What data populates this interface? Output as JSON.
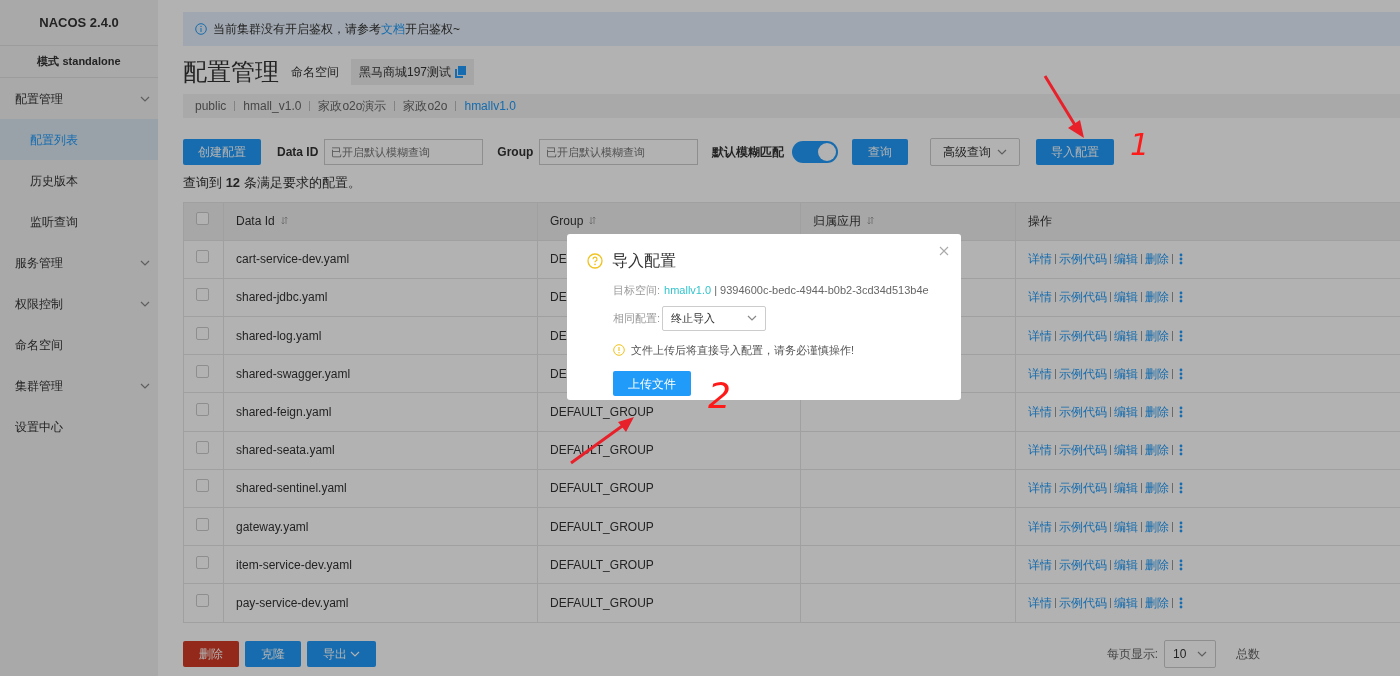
{
  "sidebar": {
    "title": "NACOS 2.4.0",
    "mode": "模式 standalone",
    "items": [
      {
        "label": "配置管理",
        "kind": "group",
        "selected": false,
        "children": [
          {
            "label": "配置列表",
            "selected": true
          },
          {
            "label": "历史版本",
            "selected": false
          },
          {
            "label": "监听查询",
            "selected": false
          }
        ]
      },
      {
        "label": "服务管理",
        "kind": "group",
        "selected": false
      },
      {
        "label": "权限控制",
        "kind": "group",
        "selected": false
      },
      {
        "label": "命名空间",
        "kind": "link",
        "selected": false
      },
      {
        "label": "集群管理",
        "kind": "group",
        "selected": false
      },
      {
        "label": "设置中心",
        "kind": "link",
        "selected": false
      }
    ]
  },
  "notice": {
    "before": "当前集群没有开启鉴权，请参考",
    "link": "文档",
    "after": "开启鉴权~"
  },
  "header": {
    "title": "配置管理",
    "namespace_label": "命名空间",
    "namespace": "黑马商城197测试"
  },
  "namespaces": [
    {
      "label": "public",
      "selected": false
    },
    {
      "label": "hmall_v1.0",
      "selected": false
    },
    {
      "label": "家政o2o演示",
      "selected": false
    },
    {
      "label": "家政o2o",
      "selected": false
    },
    {
      "label": "hmallv1.0",
      "selected": true
    }
  ],
  "toolbar": {
    "create": "创建配置",
    "dataid_label": "Data ID",
    "dataid_placeholder": "已开启默认模糊查询",
    "group_label": "Group",
    "group_placeholder": "已开启默认模糊查询",
    "fuzzy_label": "默认模糊匹配",
    "fuzzy_on": true,
    "query": "查询",
    "advanced": "高级查询",
    "import": "导入配置"
  },
  "result": "查询到 **12** 条满足要求的配置。",
  "table": {
    "select_all_checked": false,
    "columns": [
      "Data Id",
      "Group",
      "归属应用",
      "操作"
    ],
    "rows": [
      {
        "checked": false,
        "data_id": "cart-service-dev.yaml",
        "group": "DE",
        "actions": [
          "详情",
          "示例代码",
          "编辑",
          "删除"
        ]
      },
      {
        "checked": false,
        "data_id": "shared-jdbc.yaml",
        "group": "DE",
        "actions": [
          "详情",
          "示例代码",
          "编辑",
          "删除"
        ]
      },
      {
        "checked": false,
        "data_id": "shared-log.yaml",
        "group": "DE",
        "actions": [
          "详情",
          "示例代码",
          "编辑",
          "删除"
        ]
      },
      {
        "checked": false,
        "data_id": "shared-swagger.yaml",
        "group": "DE",
        "actions": [
          "详情",
          "示例代码",
          "编辑",
          "删除"
        ]
      },
      {
        "checked": false,
        "data_id": "shared-feign.yaml",
        "group": "DEFAULT_GROUP",
        "actions": [
          "详情",
          "示例代码",
          "编辑",
          "删除"
        ]
      },
      {
        "checked": false,
        "data_id": "shared-seata.yaml",
        "group": "DEFAULT_GROUP",
        "actions": [
          "详情",
          "示例代码",
          "编辑",
          "删除"
        ]
      },
      {
        "checked": false,
        "data_id": "shared-sentinel.yaml",
        "group": "DEFAULT_GROUP",
        "actions": [
          "详情",
          "示例代码",
          "编辑",
          "删除"
        ]
      },
      {
        "checked": false,
        "data_id": "gateway.yaml",
        "group": "DEFAULT_GROUP",
        "actions": [
          "详情",
          "示例代码",
          "编辑",
          "删除"
        ]
      },
      {
        "checked": false,
        "data_id": "item-service-dev.yaml",
        "group": "DEFAULT_GROUP",
        "actions": [
          "详情",
          "示例代码",
          "编辑",
          "删除"
        ]
      },
      {
        "checked": false,
        "data_id": "pay-service-dev.yaml",
        "group": "DEFAULT_GROUP",
        "actions": [
          "详情",
          "示例代码",
          "编辑",
          "删除"
        ]
      }
    ]
  },
  "footer": {
    "delete": "删除",
    "clone": "克隆",
    "export": "导出",
    "page_size_label": "每页显示:",
    "page_size": "10",
    "total_label": "总数"
  },
  "dialog": {
    "title": "导入配置",
    "target_label": "目标空间:",
    "target_name": "hmallv1.0",
    "target_id": "| 9394600c-bedc-4944-b0b2-3cd34d513b4e",
    "same_label": "相同配置:",
    "same_value": "终止导入",
    "warning": "文件上传后将直接导入配置，请务必谨慎操作!",
    "upload": "上传文件"
  },
  "annotations": {
    "marks": [
      "1",
      "2"
    ]
  }
}
